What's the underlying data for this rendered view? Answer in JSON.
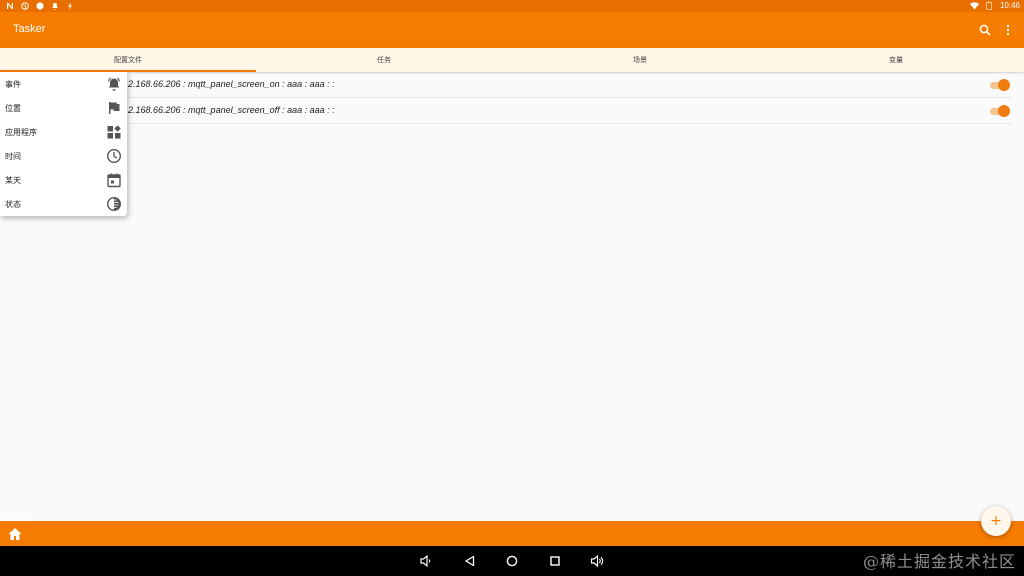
{
  "status_bar": {
    "left_icons": [
      "n-notification-icon",
      "globe-icon",
      "circle-icon",
      "bell-icon",
      "bolt-icon"
    ],
    "right_icons": [
      "wifi-icon",
      "battery-icon"
    ],
    "time": "10:46"
  },
  "app": {
    "title": "Tasker"
  },
  "appbar": {
    "actions": [
      "search-icon",
      "more-vert-icon"
    ]
  },
  "tabs": [
    {
      "label": "配置文件",
      "active": true
    },
    {
      "label": "任务",
      "active": false
    },
    {
      "label": "场景",
      "active": false
    },
    {
      "label": "变量",
      "active": false
    }
  ],
  "profiles": [
    {
      "name": "2.168.66.206 : mqtt_panel_screen_on : aaa : aaa : :",
      "enabled": true
    },
    {
      "name": "2.168.66.206 : mqtt_panel_screen_off : aaa : aaa : :",
      "enabled": true
    }
  ],
  "context_menu": {
    "items": [
      {
        "label": "事件",
        "icon": "bell-ring-icon"
      },
      {
        "label": "位置",
        "icon": "flag-icon"
      },
      {
        "label": "应用程序",
        "icon": "apps-icon"
      },
      {
        "label": "时间",
        "icon": "clock-icon"
      },
      {
        "label": "某天",
        "icon": "calendar-icon"
      },
      {
        "label": "状态",
        "icon": "contrast-icon"
      }
    ]
  },
  "bottom_bar": {
    "home_icon": "home-icon"
  },
  "fab": {
    "label": "+"
  },
  "nav_bar": {
    "buttons": [
      "volume-down-icon",
      "back-icon",
      "home-circle-icon",
      "recents-icon",
      "volume-up-icon"
    ]
  },
  "watermark": "@稀土掘金技术社区",
  "colors": {
    "primary": "#f67c00",
    "status": "#e86e00",
    "tab_bg": "#fff6e8",
    "toggle_on": "#ef7c0e"
  }
}
